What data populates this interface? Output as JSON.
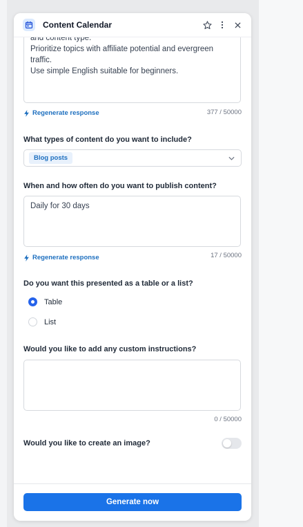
{
  "header": {
    "title": "Content Calendar"
  },
  "prompt_area": {
    "lines": [
      "and content type.",
      "",
      "Prioritize topics with affiliate potential and evergreen traffic.",
      "",
      "Use simple English suitable for beginners."
    ],
    "counter": "377 / 50000",
    "regenerate_label": "Regenerate response"
  },
  "content_types": {
    "question": "What types of content do you want to include?",
    "selected_chip": "Blog posts"
  },
  "schedule": {
    "question": "When and how often do you want to publish content?",
    "value": "Daily for 30 days",
    "counter": "17 / 50000",
    "regenerate_label": "Regenerate response"
  },
  "format": {
    "question": "Do you want this presented as a table or a list?",
    "options": [
      {
        "label": "Table",
        "selected": true
      },
      {
        "label": "List",
        "selected": false
      }
    ]
  },
  "custom": {
    "question": "Would you like to add any custom instructions?",
    "value": "",
    "counter": "0 / 50000"
  },
  "image": {
    "question": "Would you like to create an image?",
    "enabled": false
  },
  "footer": {
    "generate_label": "Generate now"
  },
  "colors": {
    "accent": "#1a73e8",
    "link": "#1d6fbf"
  }
}
